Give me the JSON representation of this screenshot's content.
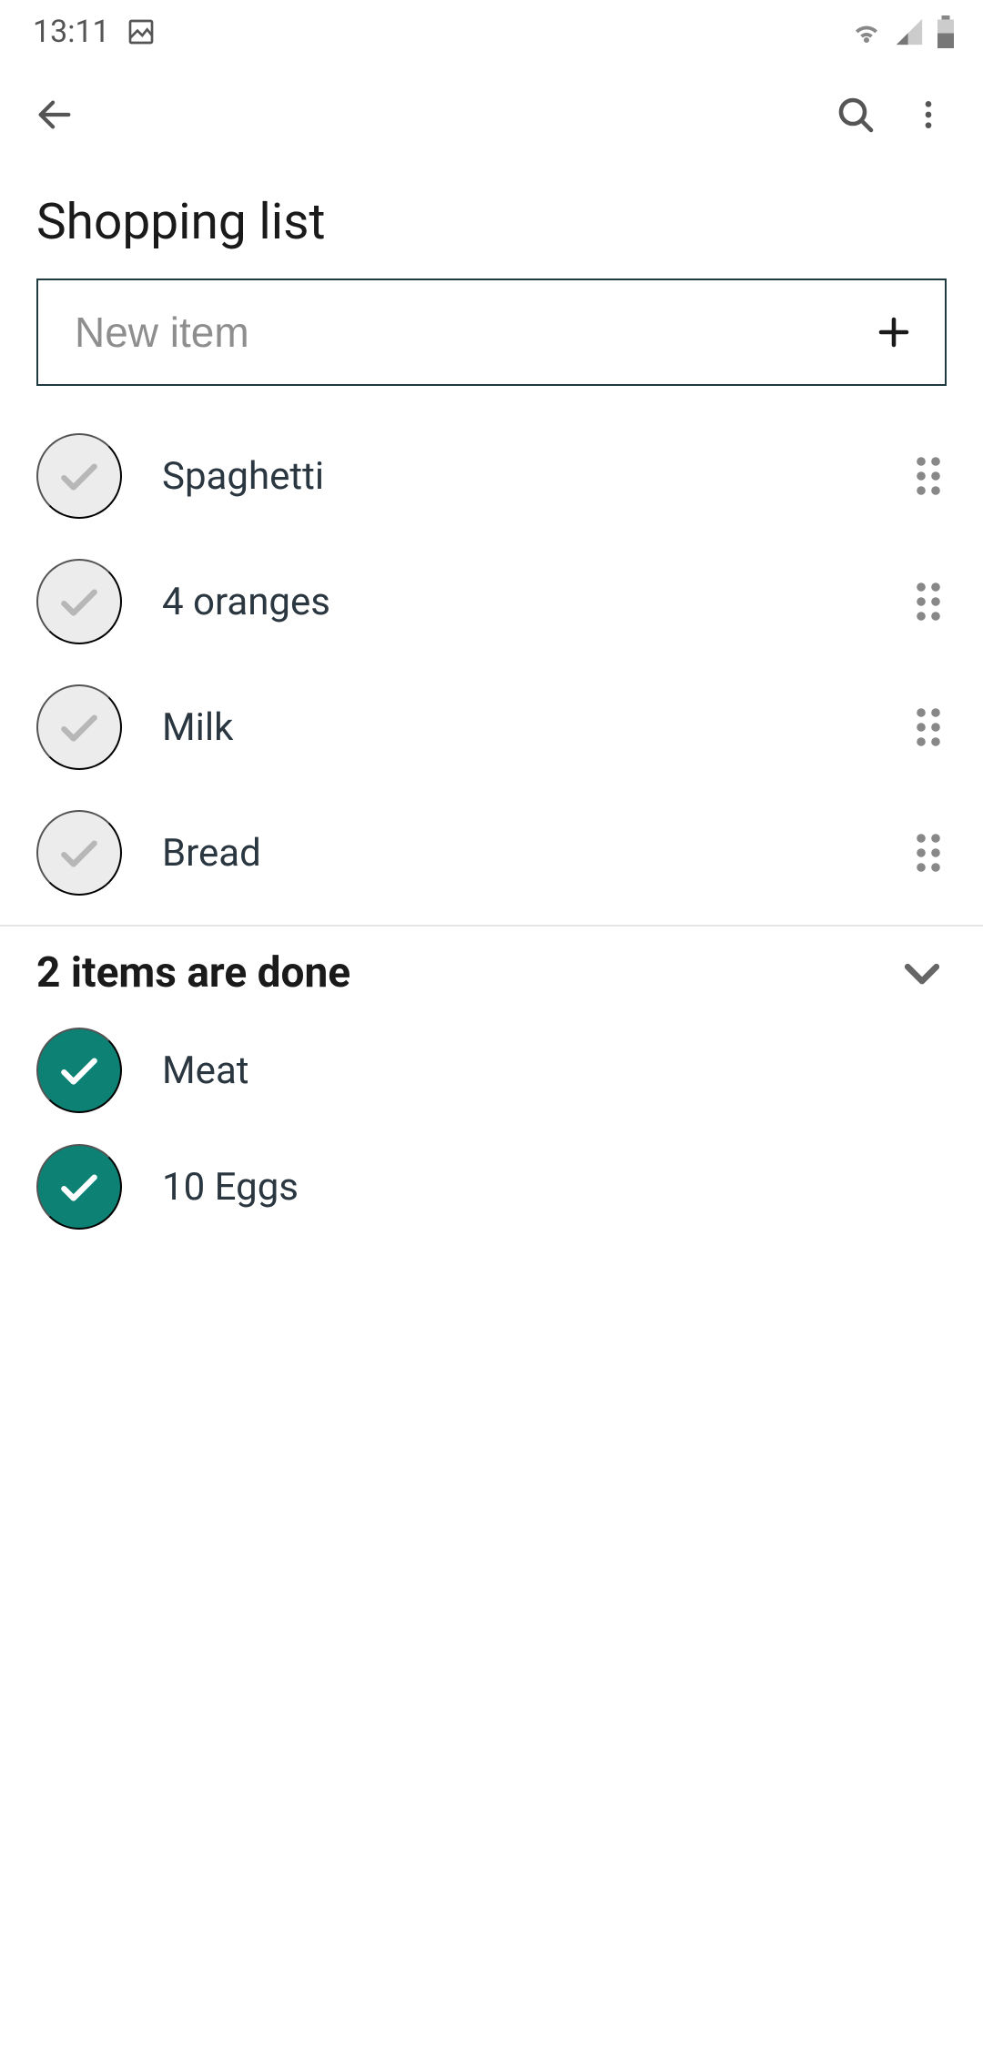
{
  "status": {
    "time": "13:11"
  },
  "header": {
    "title": "Shopping list"
  },
  "new_item": {
    "placeholder": "New item"
  },
  "items": [
    {
      "label": "Spaghetti"
    },
    {
      "label": "4 oranges"
    },
    {
      "label": "Milk"
    },
    {
      "label": "Bread"
    }
  ],
  "done": {
    "title": "2 items are done",
    "items": [
      {
        "label": "Meat"
      },
      {
        "label": "10 Eggs"
      }
    ]
  }
}
